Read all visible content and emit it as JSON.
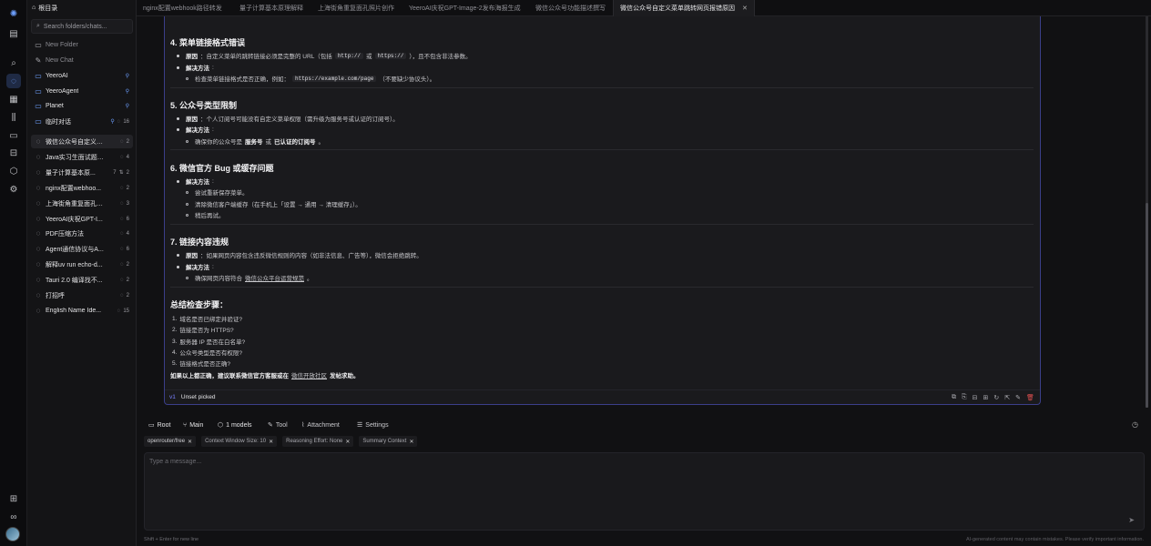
{
  "app": {
    "sidebar_title": "根目录",
    "search_placeholder": "Search folders/chats...",
    "new_folder": "New Folder",
    "new_chat": "New Chat"
  },
  "folders": [
    {
      "label": "YeeroAI",
      "pinned": true
    },
    {
      "label": "YeeroAgent",
      "pinned": true
    },
    {
      "label": "Planet",
      "pinned": true
    },
    {
      "label": "临时对话",
      "pinned": true,
      "count": "16"
    }
  ],
  "chats": [
    {
      "label": "微信公众号自定义菜...",
      "count": "2",
      "selected": true
    },
    {
      "label": "Java实习生面试题设...",
      "count": "4"
    },
    {
      "label": "量子计算基本原...",
      "count": "2",
      "extra": "7"
    },
    {
      "label": "nginx配置webhoo...",
      "count": "2"
    },
    {
      "label": "上海街角重复面孔照...",
      "count": "3"
    },
    {
      "label": "YeeroAI庆祝GPT-I...",
      "count": "6"
    },
    {
      "label": "PDF压缩方法",
      "count": "4"
    },
    {
      "label": "Agent通信协议与A...",
      "count": "6"
    },
    {
      "label": "解释uv run echo-d...",
      "count": "2"
    },
    {
      "label": "Tauri 2.0 编译找不...",
      "count": "2"
    },
    {
      "label": "打招呼",
      "count": "2"
    },
    {
      "label": "English Name Ide...",
      "count": "15"
    }
  ],
  "tabs": [
    "nginx配置webhook路径转发",
    "量子计算基本原理解释",
    "上海街角重复面孔照片创作",
    "YeeroAI庆祝GPT-Image-2发布海报生成",
    "微信公众号功能描述撰写",
    "微信公众号自定义菜单跳转网页报错原因"
  ],
  "message": {
    "s4": {
      "title": "4. 菜单链接格式错误",
      "reason_label": "原因",
      "reason_a": "：自定义菜单的跳转链接必须是完整的 URL（包括",
      "code1": "http://",
      "or": "或",
      "code2": "https://",
      "reason_b": "），且不包含非法参数。",
      "sol_label": "解决方法",
      "sol1_a": "检查菜单链接格式是否正确，例如：",
      "sol1_code": "https://example.com/page",
      "sol1_b": "（不要缺少协议头）。"
    },
    "s5": {
      "title": "5. 公众号类型限制",
      "reason_label": "原因",
      "reason": "：个人订阅号可能没有自定义菜单权限（需升级为服务号或认证的订阅号）。",
      "sol_label": "解决方法",
      "sol1_a": "确保你的公众号是",
      "sol1_b1": "服务号",
      "sol1_or": "或",
      "sol1_b2": "已认证的订阅号",
      "sol1_c": "。"
    },
    "s6": {
      "title": "6. 微信官方 Bug 或缓存问题",
      "sol_label": "解决方法",
      "sol1": "尝试重新保存菜单。",
      "sol2": "清除微信客户端缓存（在手机上「设置 → 通用 → 清理缓存」）。",
      "sol3": "稍后再试。"
    },
    "s7": {
      "title": "7. 链接内容违规",
      "reason_label": "原因",
      "reason": "：如果网页内容包含违反微信规则的内容（如非法信息、广告等），微信会拒绝跳转。",
      "sol_label": "解决方法",
      "sol1_a": "确保网页内容符合",
      "sol1_link": "微信公众平台运营规范",
      "sol1_b": "。"
    },
    "summary": {
      "title": "总结检查步骤：",
      "steps": [
        "域名是否已绑定并验证?",
        "链接是否为 HTTPS?",
        "服务器 IP 是否在白名单?",
        "公众号类型是否有权限?",
        "链接格式是否正确?"
      ],
      "final_a": "如果以上都正确，建议联系微信官方客服或在",
      "final_link": "微信开放社区",
      "final_b": "发帖求助。"
    },
    "version": "v1",
    "picked": "Unset picked"
  },
  "toolbar": {
    "root": "Root",
    "main": "Main",
    "models": "1 models",
    "tool": "Tool",
    "attachment": "Attachment",
    "settings": "Settings"
  },
  "chips": [
    "openrouter/free",
    "Context Window Size: 10",
    "Reasoning Effort: None",
    "Summary Context"
  ],
  "input": {
    "placeholder": "Type a message...",
    "hint": "Shift + Enter for new line",
    "disclaimer": "AI-generated content may contain mistakes. Please verify important information."
  },
  "colors": {
    "accent": "#6ea0ff",
    "border_active": "#3b3f8a",
    "danger": "#e05050"
  }
}
